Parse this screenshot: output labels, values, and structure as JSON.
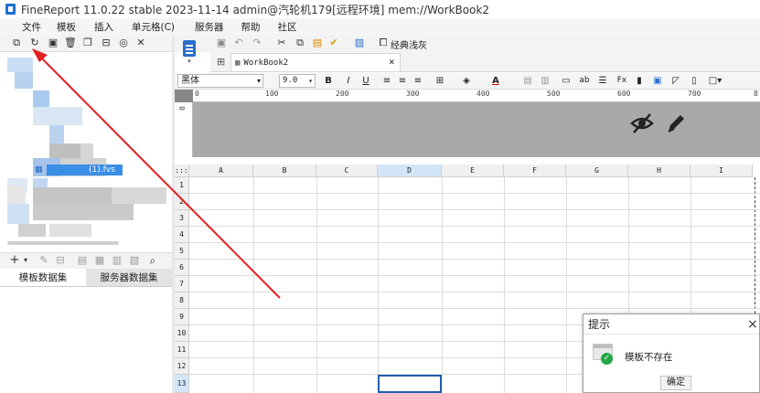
{
  "window": {
    "title": "FineReport 11.0.22 stable 2023-11-14 admin@汽轮机179[远程环境]    mem://WorkBook2"
  },
  "menu": {
    "items": [
      "文件",
      "模板",
      "插入",
      "单元格(C)",
      "服务器",
      "帮助",
      "社区"
    ]
  },
  "toolbar": {
    "theme_label": "经典浅灰"
  },
  "tree": {
    "selected_item": "(1).fvs"
  },
  "dataset_tabs": [
    "模板数据集",
    "服务器数据集"
  ],
  "document_tab": {
    "label": "WorkBook2",
    "close": "×"
  },
  "format": {
    "font_name": "黑体",
    "font_size": "9.0",
    "bold": "B",
    "italic": "I",
    "underline": "U",
    "dropdown": "▾"
  },
  "ruler": {
    "ticks": [
      "0",
      "100",
      "200",
      "300",
      "400",
      "500",
      "600",
      "700",
      "8"
    ],
    "vertical_zero": "0"
  },
  "grid": {
    "corner": ":::",
    "columns": [
      "A",
      "B",
      "C",
      "D",
      "E",
      "F",
      "G",
      "H",
      "I"
    ],
    "rows": [
      "1",
      "2",
      "3",
      "4",
      "5",
      "6",
      "7",
      "8",
      "9",
      "10",
      "11",
      "12",
      "13"
    ],
    "selected_column": "D",
    "selected_row": "13"
  },
  "dialog": {
    "title": "提示",
    "message": "模板不存在",
    "ok_label": "确定",
    "close": "×"
  },
  "colors": {
    "accent": "#3a8ee6",
    "annotation_arrow": "#e02020",
    "dialog_success": "#21a846"
  }
}
